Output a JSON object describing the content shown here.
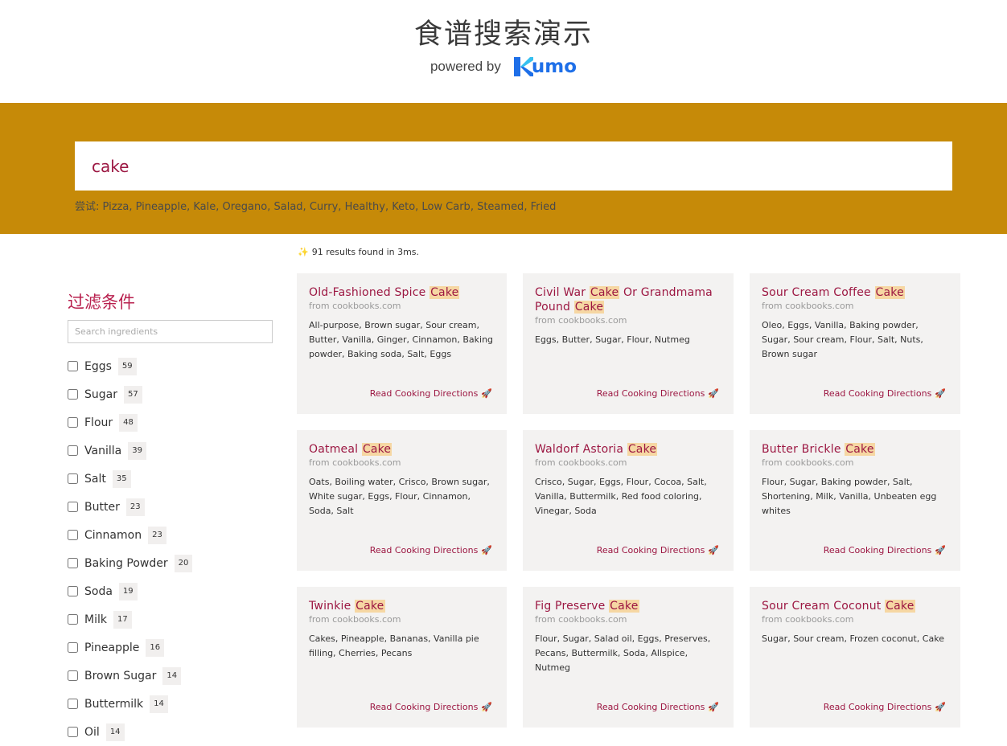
{
  "header": {
    "title": "食谱搜索演示",
    "powered_by": "powered by",
    "logo_text": "umo",
    "logo_k": "K"
  },
  "search": {
    "value": "cake",
    "suggest_prefix": "尝试:",
    "suggestions": [
      "Pizza",
      "Pineapple",
      "Kale",
      "Oregano",
      "Salad",
      "Curry",
      "Healthy",
      "Keto",
      "Low Carb",
      "Steamed",
      "Fried"
    ]
  },
  "sidebar": {
    "title": "过滤条件",
    "search_placeholder": "Search ingredients",
    "facets": [
      {
        "name": "Eggs",
        "count": "59"
      },
      {
        "name": "Sugar",
        "count": "57"
      },
      {
        "name": "Flour",
        "count": "48"
      },
      {
        "name": "Vanilla",
        "count": "39"
      },
      {
        "name": "Salt",
        "count": "35"
      },
      {
        "name": "Butter",
        "count": "23"
      },
      {
        "name": "Cinnamon",
        "count": "23"
      },
      {
        "name": "Baking Powder",
        "count": "20"
      },
      {
        "name": "Soda",
        "count": "19"
      },
      {
        "name": "Milk",
        "count": "17"
      },
      {
        "name": "Pineapple",
        "count": "16"
      },
      {
        "name": "Brown Sugar",
        "count": "14"
      },
      {
        "name": "Buttermilk",
        "count": "14"
      },
      {
        "name": "Oil",
        "count": "14"
      }
    ]
  },
  "results": {
    "info": "91 results found in 3ms.",
    "highlight": "Cake",
    "link_label": "Read Cooking Directions",
    "cards": [
      {
        "title_parts": [
          "Old-Fashioned Spice ",
          "Cake"
        ],
        "source": "from cookbooks.com",
        "ingredients": "All-purpose, Brown sugar, Sour cream, Butter, Vanilla, Ginger, Cinnamon, Baking powder, Baking soda, Salt, Eggs"
      },
      {
        "title_parts": [
          "Civil War ",
          "Cake",
          " Or Grandmama Pound ",
          "Cake"
        ],
        "source": "from cookbooks.com",
        "ingredients": "Eggs, Butter, Sugar, Flour, Nutmeg"
      },
      {
        "title_parts": [
          "Sour Cream Coffee ",
          "Cake"
        ],
        "source": "from cookbooks.com",
        "ingredients": "Oleo, Eggs, Vanilla, Baking powder, Sugar, Sour cream, Flour, Salt, Nuts, Brown sugar"
      },
      {
        "title_parts": [
          "Oatmeal ",
          "Cake"
        ],
        "source": "from cookbooks.com",
        "ingredients": "Oats, Boiling water, Crisco, Brown sugar, White sugar, Eggs, Flour, Cinnamon, Soda, Salt"
      },
      {
        "title_parts": [
          "Waldorf Astoria ",
          "Cake"
        ],
        "source": "from cookbooks.com",
        "ingredients": "Crisco, Sugar, Eggs, Flour, Cocoa, Salt, Vanilla, Buttermilk, Red food coloring, Vinegar, Soda"
      },
      {
        "title_parts": [
          "Butter Brickle ",
          "Cake"
        ],
        "source": "from cookbooks.com",
        "ingredients": "Flour, Sugar, Baking powder, Salt, Shortening, Milk, Vanilla, Unbeaten egg whites"
      },
      {
        "title_parts": [
          "Twinkie ",
          "Cake"
        ],
        "source": "from cookbooks.com",
        "ingredients": "Cakes, Pineapple, Bananas, Vanilla pie filling, Cherries, Pecans"
      },
      {
        "title_parts": [
          "Fig Preserve ",
          "Cake"
        ],
        "source": "from cookbooks.com",
        "ingredients": "Flour, Sugar, Salad oil, Eggs, Preserves, Pecans, Buttermilk, Soda, Allspice, Nutmeg"
      },
      {
        "title_parts": [
          "Sour Cream Coconut ",
          "Cake"
        ],
        "source": "from cookbooks.com",
        "ingredients": "Sugar, Sour cream, Frozen coconut, Cake"
      }
    ]
  },
  "colors": {
    "band": "#c68a08",
    "accent": "#9c1742",
    "highlight": "#f6d7a3",
    "logo": "#1e6fe8"
  },
  "icons": {
    "sparkle": "sparkle-icon",
    "rocket": "rocket-icon"
  }
}
